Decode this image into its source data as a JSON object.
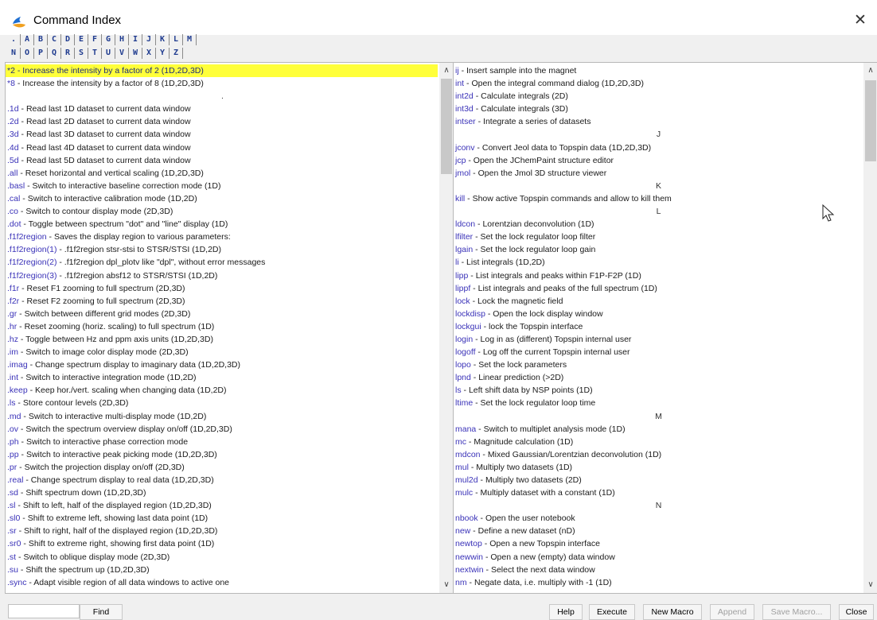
{
  "window": {
    "title": "Command Index",
    "close_symbol": "✕",
    "icon": "topspin-app-icon",
    "accent": "#1f6fd1"
  },
  "letters": {
    "row1": [
      ".",
      "A",
      "B",
      "C",
      "D",
      "E",
      "F",
      "G",
      "H",
      "I",
      "J",
      "K",
      "L",
      "M"
    ],
    "row2": [
      "N",
      "O",
      "P",
      "Q",
      "R",
      "S",
      "T",
      "U",
      "V",
      "W",
      "X",
      "Y",
      "Z"
    ]
  },
  "left_list": [
    {
      "type": "item",
      "cmd": "*2",
      "desc": "Increase the intensity by a factor of 2 (1D,2D,3D)",
      "selected": true
    },
    {
      "type": "item",
      "cmd": "*8",
      "desc": "Increase the intensity by a factor of 8 (1D,2D,3D)"
    },
    {
      "type": "header",
      "text": "."
    },
    {
      "type": "item",
      "cmd": ".1d",
      "desc": "Read last 1D dataset to current data window"
    },
    {
      "type": "item",
      "cmd": ".2d",
      "desc": "Read last 2D dataset to current data window"
    },
    {
      "type": "item",
      "cmd": ".3d",
      "desc": "Read last 3D dataset to current data window"
    },
    {
      "type": "item",
      "cmd": ".4d",
      "desc": "Read last 4D dataset to current data window"
    },
    {
      "type": "item",
      "cmd": ".5d",
      "desc": "Read last 5D dataset to current data window"
    },
    {
      "type": "item",
      "cmd": ".all",
      "desc": "Reset horizontal and vertical scaling (1D,2D,3D)"
    },
    {
      "type": "item",
      "cmd": ".basl",
      "desc": "Switch to interactive baseline correction mode (1D)"
    },
    {
      "type": "item",
      "cmd": ".cal",
      "desc": "Switch to interactive calibration mode (1D,2D)"
    },
    {
      "type": "item",
      "cmd": ".co",
      "desc": "Switch to contour display mode (2D,3D)"
    },
    {
      "type": "item",
      "cmd": ".dot",
      "desc": "Toggle between spectrum \"dot\" and \"line\" display (1D)"
    },
    {
      "type": "item",
      "cmd": ".f1f2region",
      "desc": "Saves the display region to various parameters:"
    },
    {
      "type": "item",
      "cmd": ".f1f2region(1)",
      "desc": ".f1f2region stsr-stsi to STSR/STSI (1D,2D)"
    },
    {
      "type": "item",
      "cmd": ".f1f2region(2)",
      "desc": ".f1f2region dpl_plotv like \"dpl\", without error messages"
    },
    {
      "type": "item",
      "cmd": ".f1f2region(3)",
      "desc": ".f1f2region absf12 to STSR/STSI (1D,2D)"
    },
    {
      "type": "item",
      "cmd": ".f1r",
      "desc": "Reset F1 zooming to full spectrum (2D,3D)"
    },
    {
      "type": "item",
      "cmd": ".f2r",
      "desc": "Reset F2 zooming to full spectrum (2D,3D)"
    },
    {
      "type": "item",
      "cmd": ".gr",
      "desc": "Switch between different grid modes (2D,3D)"
    },
    {
      "type": "item",
      "cmd": ".hr",
      "desc": "Reset zooming (horiz. scaling) to full spectrum (1D)"
    },
    {
      "type": "item",
      "cmd": ".hz",
      "desc": "Toggle between Hz and ppm axis units (1D,2D,3D)"
    },
    {
      "type": "item",
      "cmd": ".im",
      "desc": "Switch to image color display mode (2D,3D)"
    },
    {
      "type": "item",
      "cmd": ".imag",
      "desc": "Change spectrum display to imaginary data (1D,2D,3D)"
    },
    {
      "type": "item",
      "cmd": ".int",
      "desc": "Switch to interactive integration mode (1D,2D)"
    },
    {
      "type": "item",
      "cmd": ".keep",
      "desc": "Keep hor./vert. scaling when changing data (1D,2D)"
    },
    {
      "type": "item",
      "cmd": ".ls",
      "desc": "Store contour levels (2D,3D)"
    },
    {
      "type": "item",
      "cmd": ".md",
      "desc": "Switch to interactive multi-display mode (1D,2D)"
    },
    {
      "type": "item",
      "cmd": ".ov",
      "desc": "Switch the spectrum overview display on/off (1D,2D,3D)"
    },
    {
      "type": "item",
      "cmd": ".ph",
      "desc": "Switch to interactive phase correction mode"
    },
    {
      "type": "item",
      "cmd": ".pp",
      "desc": "Switch to interactive peak picking mode (1D,2D,3D)"
    },
    {
      "type": "item",
      "cmd": ".pr",
      "desc": "Switch the projection display on/off (2D,3D)"
    },
    {
      "type": "item",
      "cmd": ".real",
      "desc": "Change spectrum display to real data (1D,2D,3D)"
    },
    {
      "type": "item",
      "cmd": ".sd",
      "desc": "Shift spectrum down (1D,2D,3D)"
    },
    {
      "type": "item",
      "cmd": ".sl",
      "desc": "Shift to left, half of the displayed region (1D,2D,3D)"
    },
    {
      "type": "item",
      "cmd": ".sl0",
      "desc": "Shift to extreme left, showing last data point (1D)"
    },
    {
      "type": "item",
      "cmd": ".sr",
      "desc": "Shift to right, half of the displayed region (1D,2D,3D)"
    },
    {
      "type": "item",
      "cmd": ".sr0",
      "desc": "Shift to extreme right, showing first data point (1D)"
    },
    {
      "type": "item",
      "cmd": ".st",
      "desc": "Switch to oblique display mode (2D,3D)"
    },
    {
      "type": "item",
      "cmd": ".su",
      "desc": "Shift the spectrum up (1D,2D,3D)"
    },
    {
      "type": "item",
      "cmd": ".sync",
      "desc": "Adapt visible region of all data windows to active one"
    }
  ],
  "right_list": [
    {
      "type": "item",
      "cmd": "ij",
      "desc": "Insert sample into the magnet"
    },
    {
      "type": "item",
      "cmd": "int",
      "desc": "Open the integral command dialog (1D,2D,3D)"
    },
    {
      "type": "item",
      "cmd": "int2d",
      "desc": "Calculate integrals (2D)"
    },
    {
      "type": "item",
      "cmd": "int3d",
      "desc": "Calculate integrals (3D)"
    },
    {
      "type": "item",
      "cmd": "intser",
      "desc": "Integrate a series of datasets"
    },
    {
      "type": "header",
      "text": "J"
    },
    {
      "type": "item",
      "cmd": "jconv",
      "desc": "Convert Jeol data to Topspin data (1D,2D,3D)"
    },
    {
      "type": "item",
      "cmd": "jcp",
      "desc": "Open the JChemPaint structure editor"
    },
    {
      "type": "item",
      "cmd": "jmol",
      "desc": "Open the Jmol 3D structure viewer"
    },
    {
      "type": "header",
      "text": "K"
    },
    {
      "type": "item",
      "cmd": "kill",
      "desc": "Show active Topspin commands and allow to kill them"
    },
    {
      "type": "header",
      "text": "L"
    },
    {
      "type": "item",
      "cmd": "ldcon",
      "desc": "Lorentzian deconvolution (1D)"
    },
    {
      "type": "item",
      "cmd": "lfilter",
      "desc": "Set the lock regulator loop filter"
    },
    {
      "type": "item",
      "cmd": "lgain",
      "desc": "Set the lock regulator loop gain"
    },
    {
      "type": "item",
      "cmd": "li",
      "desc": "List integrals (1D,2D)"
    },
    {
      "type": "item",
      "cmd": "lipp",
      "desc": "List integrals and peaks within F1P-F2P (1D)"
    },
    {
      "type": "item",
      "cmd": "lippf",
      "desc": "List integrals and peaks of the full spectrum (1D)"
    },
    {
      "type": "item",
      "cmd": "lock",
      "desc": "Lock the magnetic field"
    },
    {
      "type": "item",
      "cmd": "lockdisp",
      "desc": "Open the lock display window"
    },
    {
      "type": "item",
      "cmd": "lockgui",
      "desc": "lock the Topspin interface"
    },
    {
      "type": "item",
      "cmd": "login",
      "desc": "Log in as (different) Topspin internal user"
    },
    {
      "type": "item",
      "cmd": "logoff",
      "desc": "Log off the current Topspin internal user"
    },
    {
      "type": "item",
      "cmd": "lopo",
      "desc": "Set the lock parameters"
    },
    {
      "type": "item",
      "cmd": "lpnd",
      "desc": "Linear prediction (>2D)"
    },
    {
      "type": "item",
      "cmd": "ls",
      "desc": "Left shift data by NSP points (1D)"
    },
    {
      "type": "item",
      "cmd": "ltime",
      "desc": "Set the lock regulator loop time"
    },
    {
      "type": "header",
      "text": "M"
    },
    {
      "type": "item",
      "cmd": "mana",
      "desc": "Switch to multiplet analysis mode (1D)"
    },
    {
      "type": "item",
      "cmd": "mc",
      "desc": "Magnitude calculation (1D)"
    },
    {
      "type": "item",
      "cmd": "mdcon",
      "desc": "Mixed Gaussian/Lorentzian deconvolution (1D)"
    },
    {
      "type": "item",
      "cmd": "mul",
      "desc": "Multiply two datasets (1D)"
    },
    {
      "type": "item",
      "cmd": "mul2d",
      "desc": "Multiply two datasets (2D)"
    },
    {
      "type": "item",
      "cmd": "mulc",
      "desc": "Multiply dataset with a constant (1D)"
    },
    {
      "type": "header",
      "text": "N"
    },
    {
      "type": "item",
      "cmd": "nbook",
      "desc": "Open the user notebook"
    },
    {
      "type": "item",
      "cmd": "new",
      "desc": "Define a new dataset (nD)"
    },
    {
      "type": "item",
      "cmd": "newtop",
      "desc": "Open a new Topspin interface"
    },
    {
      "type": "item",
      "cmd": "newwin",
      "desc": "Open a new (empty) data window"
    },
    {
      "type": "item",
      "cmd": "nextwin",
      "desc": "Select the next data window"
    },
    {
      "type": "item",
      "cmd": "nm",
      "desc": "Negate data, i.e. multiply with -1 (1D)"
    }
  ],
  "bottom": {
    "find_value": "",
    "find_label": "Find",
    "buttons": {
      "help": "Help",
      "execute": "Execute",
      "new_macro": "New Macro",
      "append": "Append",
      "save_macro": "Save Macro...",
      "close": "Close"
    },
    "disabled_color": "#a0a0a0"
  },
  "colors": {
    "command_link": "#3a32b8",
    "selection": "#ffff3a",
    "letter_link": "#1f3b8f"
  }
}
